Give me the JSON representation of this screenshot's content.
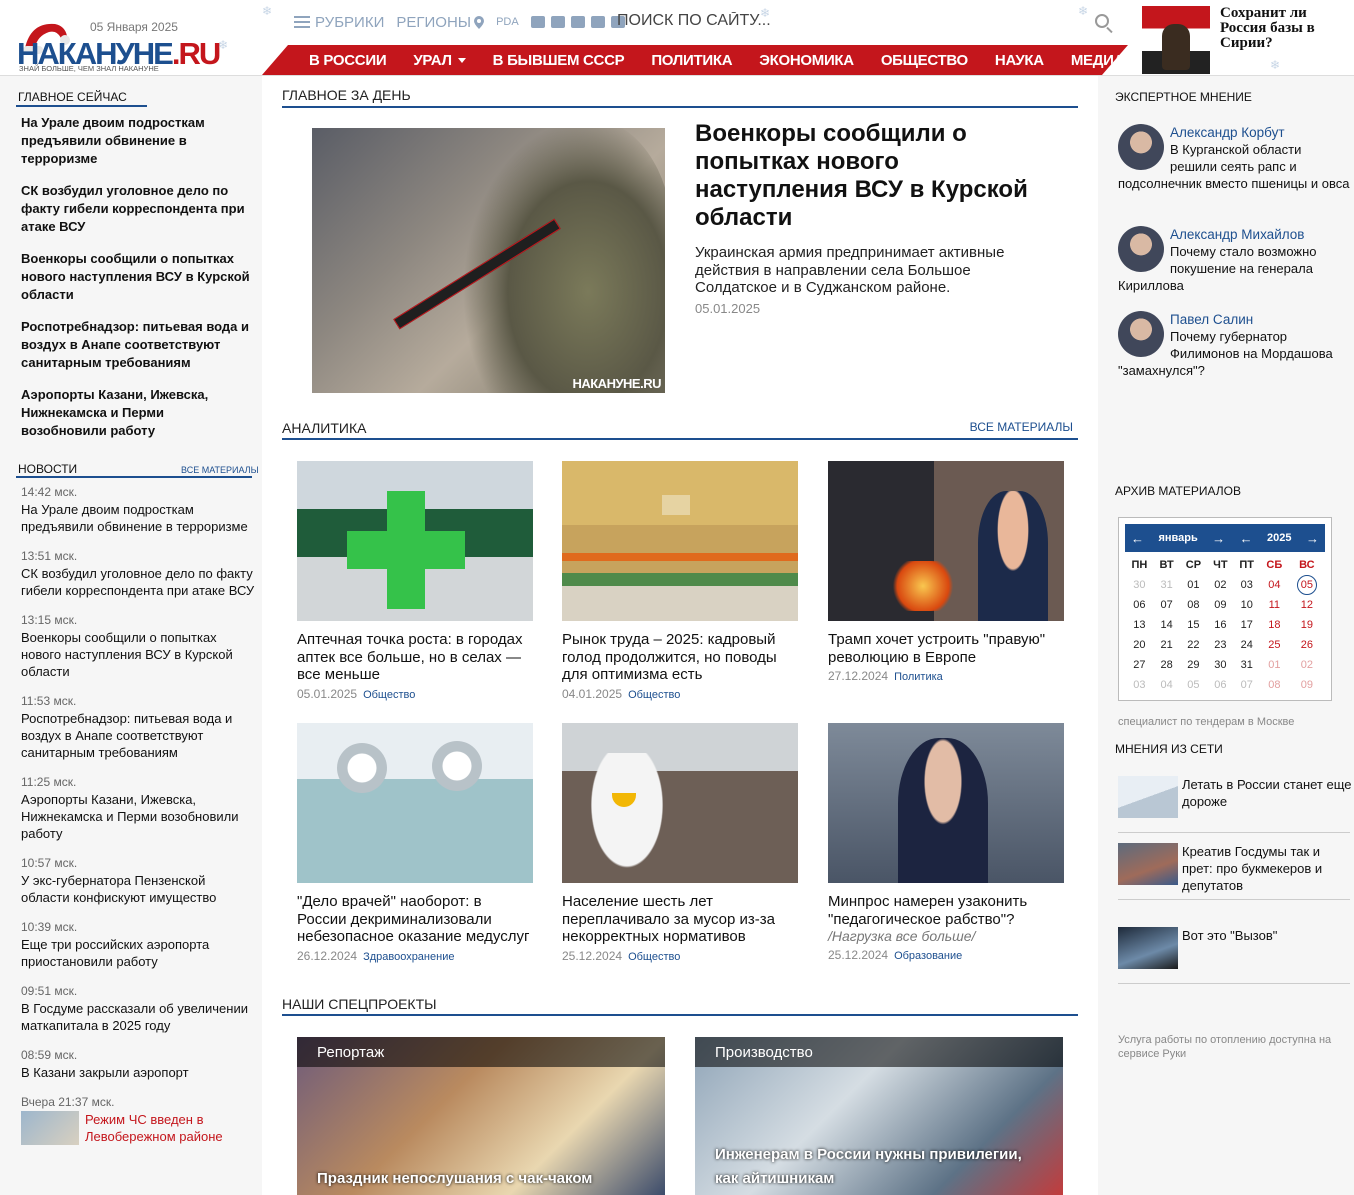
{
  "header": {
    "logo_text_main": "НАКАНУНЕ",
    "logo_text_tld": ".RU",
    "logo_slogan": "ЗНАЙ БОЛЬШЕ, ЧЕМ ЗНАЛ НАКАНУНЕ",
    "date": "05 Января 2025",
    "nav_rubrics": "РУБРИКИ",
    "nav_regions": "РЕГИОНЫ",
    "nav_pda": "PDA",
    "search_placeholder": "ПОИСК ПО САЙТУ...",
    "promo_text": "Сохранит ли Россия базы в Сирии?"
  },
  "menu": [
    "В РОССИИ",
    "УРАЛ",
    "В БЫВШЕМ СССР",
    "ПОЛИТИКА",
    "ЭКОНОМИКА",
    "ОБЩЕСТВО",
    "НАУКА",
    "МЕДИА"
  ],
  "left": {
    "main_now_title": "ГЛАВНОЕ СЕЙЧАС",
    "main_now": [
      "На Урале двоим подросткам предъявили обвинение в терроризме",
      "СК возбудил уголовное дело по факту гибели корреспондента при атаке ВСУ",
      "Военкоры сообщили о попытках нового наступления ВСУ в Курской области",
      "Роспотребнадзор: питьевая вода и воздух в Анапе соответствуют санитарным требованиям",
      "Аэропорты Казани, Ижевска, Нижнекамска и Перми возобновили работу"
    ],
    "news_title": "НОВОСТИ",
    "news_all": "ВСЕ МАТЕРИАЛЫ",
    "news": [
      {
        "time": "14:42 мск.",
        "text": "На Урале двоим подросткам предъявили обвинение в терроризме"
      },
      {
        "time": "13:51 мск.",
        "text": "СК возбудил уголовное дело по факту гибели корреспондента при атаке ВСУ"
      },
      {
        "time": "13:15 мск.",
        "text": "Военкоры сообщили о попытках нового наступления ВСУ в Курской области"
      },
      {
        "time": "11:53 мск.",
        "text": "Роспотребнадзор: питьевая вода и воздух в Анапе соответствуют санитарным требованиям"
      },
      {
        "time": "11:25 мск.",
        "text": "Аэропорты Казани, Ижевска, Нижнекамска и Перми возобновили работу"
      },
      {
        "time": "10:57 мск.",
        "text": "У экс-губернатора Пензенской области конфискуют имущество"
      },
      {
        "time": "10:39 мск.",
        "text": "Еще три российских аэропорта приостановили работу"
      },
      {
        "time": "09:51 мск.",
        "text": "В Госдуме рассказали об увеличении маткапитала в 2025 году"
      },
      {
        "time": "08:59 мск.",
        "text": "В Казани закрыли аэропорт"
      }
    ],
    "news_last_time": "Вчера 21:37 мск.",
    "news_last_text": "Режим ЧС введен в Левобережном районе"
  },
  "center": {
    "main_day_title": "ГЛАВНОЕ ЗА ДЕНЬ",
    "lead_watermark": "НАКАНУНЕ.RU",
    "lead_title": "Военкоры сообщили о попытках нового наступления ВСУ в Курской области",
    "lead_sub": "Украинская армия предпринимает активные действия в направлении села Большое Солдатское и в Суджанском районе.",
    "lead_date": "05.01.2025",
    "analytics_title": "АНАЛИТИКА",
    "analytics_all": "ВСЕ МАТЕРИАЛЫ",
    "analytics": [
      {
        "title": "Аптечная точка роста: в городах аптек все больше, но в селах — все меньше",
        "date": "05.01.2025",
        "cat": "Общество"
      },
      {
        "title": "Рынок труда – 2025: кадровый голод продолжится, но поводы для оптимизма есть",
        "date": "04.01.2025",
        "cat": "Общество"
      },
      {
        "title": "Трамп хочет устроить \"правую\" революцию в Европе",
        "date": "27.12.2024",
        "cat": "Политика"
      },
      {
        "title": "\"Дело врачей\" наоборот: в России декриминализовали небезопасное оказание медуслуг",
        "date": "26.12.2024",
        "cat": "Здравоохранение"
      },
      {
        "title": "Население шесть лет переплачивало за мусор из-за некорректных нормативов",
        "date": "25.12.2024",
        "cat": "Общество"
      },
      {
        "title": "Минпрос намерен узаконить \"педагогическое рабство\"?",
        "note": "/Нагрузка все больше/",
        "date": "25.12.2024",
        "cat": "Образование"
      }
    ],
    "special_title": "НАШИ СПЕЦПРОЕКТЫ",
    "special": [
      {
        "label": "Репортаж",
        "title": "Праздник непослушания с чак-чаком"
      },
      {
        "label": "Производство",
        "title": "Инженерам в России нужны привилегии, как айтишникам"
      }
    ]
  },
  "right": {
    "expert_title": "ЭКСПЕРТНОЕ МНЕНИЕ",
    "experts": [
      {
        "name": "Александр Корбут",
        "text": "В Курганской области решили сеять рапс и подсолнечник вместо пшеницы и овса"
      },
      {
        "name": "Александр Михайлов",
        "text": "Почему стало возможно покушение на генерала Кириллова"
      },
      {
        "name": "Павел Салин",
        "text": "Почему губернатор Филимонов на Мордашова \"замахнулся\"?"
      }
    ],
    "archive_title": "АРХИВ МАТЕРИАЛОВ",
    "calendar": {
      "month": "январь",
      "year": "2025",
      "weekdays": [
        "ПН",
        "ВТ",
        "СР",
        "ЧТ",
        "ПТ",
        "СБ",
        "ВС"
      ],
      "weeks": [
        [
          "30",
          "31",
          "01",
          "02",
          "03",
          "04",
          "05"
        ],
        [
          "06",
          "07",
          "08",
          "09",
          "10",
          "11",
          "12"
        ],
        [
          "13",
          "14",
          "15",
          "16",
          "17",
          "18",
          "19"
        ],
        [
          "20",
          "21",
          "22",
          "23",
          "24",
          "25",
          "26"
        ],
        [
          "27",
          "28",
          "29",
          "30",
          "31",
          "01",
          "02"
        ],
        [
          "03",
          "04",
          "05",
          "06",
          "07",
          "08",
          "09"
        ]
      ]
    },
    "ad_text_1": "специалист по тендерам в Москве",
    "opinions_title": "МНЕНИЯ ИЗ СЕТИ",
    "opinions": [
      "Летать в России станет еще дороже",
      "Креатив Госдумы так и прет: про букмекеров и депутатов",
      "Вот это \"Вызов\""
    ],
    "ad_text_2": "Услуга работы по отоплению доступна на сервисе Руки"
  },
  "colors": {
    "accent": "#c4161c",
    "brand_blue": "#1d4f8f"
  }
}
